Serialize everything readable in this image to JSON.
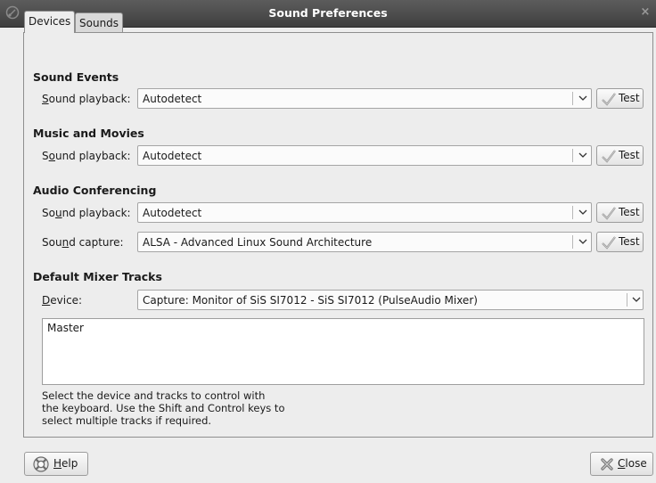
{
  "window": {
    "title": "Sound Preferences"
  },
  "tabs": [
    {
      "label": "Devices",
      "active": true
    },
    {
      "label": "Sounds",
      "active": false
    }
  ],
  "sections": {
    "sound_events": {
      "heading": "Sound Events",
      "playback": {
        "pre": "",
        "mn": "S",
        "post": "ound playback:",
        "value": "Autodetect",
        "test": "Test"
      }
    },
    "music_movies": {
      "heading": "Music and Movies",
      "playback": {
        "pre": "S",
        "mn": "o",
        "post": "und playback:",
        "value": "Autodetect",
        "test": "Test"
      }
    },
    "audio_conf": {
      "heading": "Audio Conferencing",
      "playback": {
        "pre": "So",
        "mn": "u",
        "post": "nd playback:",
        "value": "Autodetect",
        "test": "Test"
      },
      "capture": {
        "pre": "Sou",
        "mn": "n",
        "post": "d capture:",
        "value": "ALSA - Advanced Linux Sound Architecture",
        "test": "Test"
      }
    },
    "mixer": {
      "heading": "Default Mixer Tracks",
      "device": {
        "pre": "",
        "mn": "D",
        "post": "evice:",
        "value": "Capture: Monitor of SiS SI7012 - SiS SI7012 (PulseAudio Mixer)"
      },
      "tracks": [
        "Master"
      ],
      "hint": [
        "Select the device and tracks to control with",
        "the keyboard. Use the Shift and Control keys to",
        "select multiple tracks if required."
      ]
    }
  },
  "buttons": {
    "help": {
      "mn": "H",
      "post": "elp"
    },
    "close": {
      "mn": "C",
      "post": "lose"
    }
  },
  "icons": {
    "app": "sound-preferences-icon",
    "test": "checkmark-icon",
    "help": "lifebuoy-icon",
    "close": "close-x-icon",
    "dropdown": "chevron-down-icon"
  },
  "colors": {
    "titlebar": "#4a4a4a",
    "window_bg": "#ededed",
    "title_text": "#ffffff"
  }
}
